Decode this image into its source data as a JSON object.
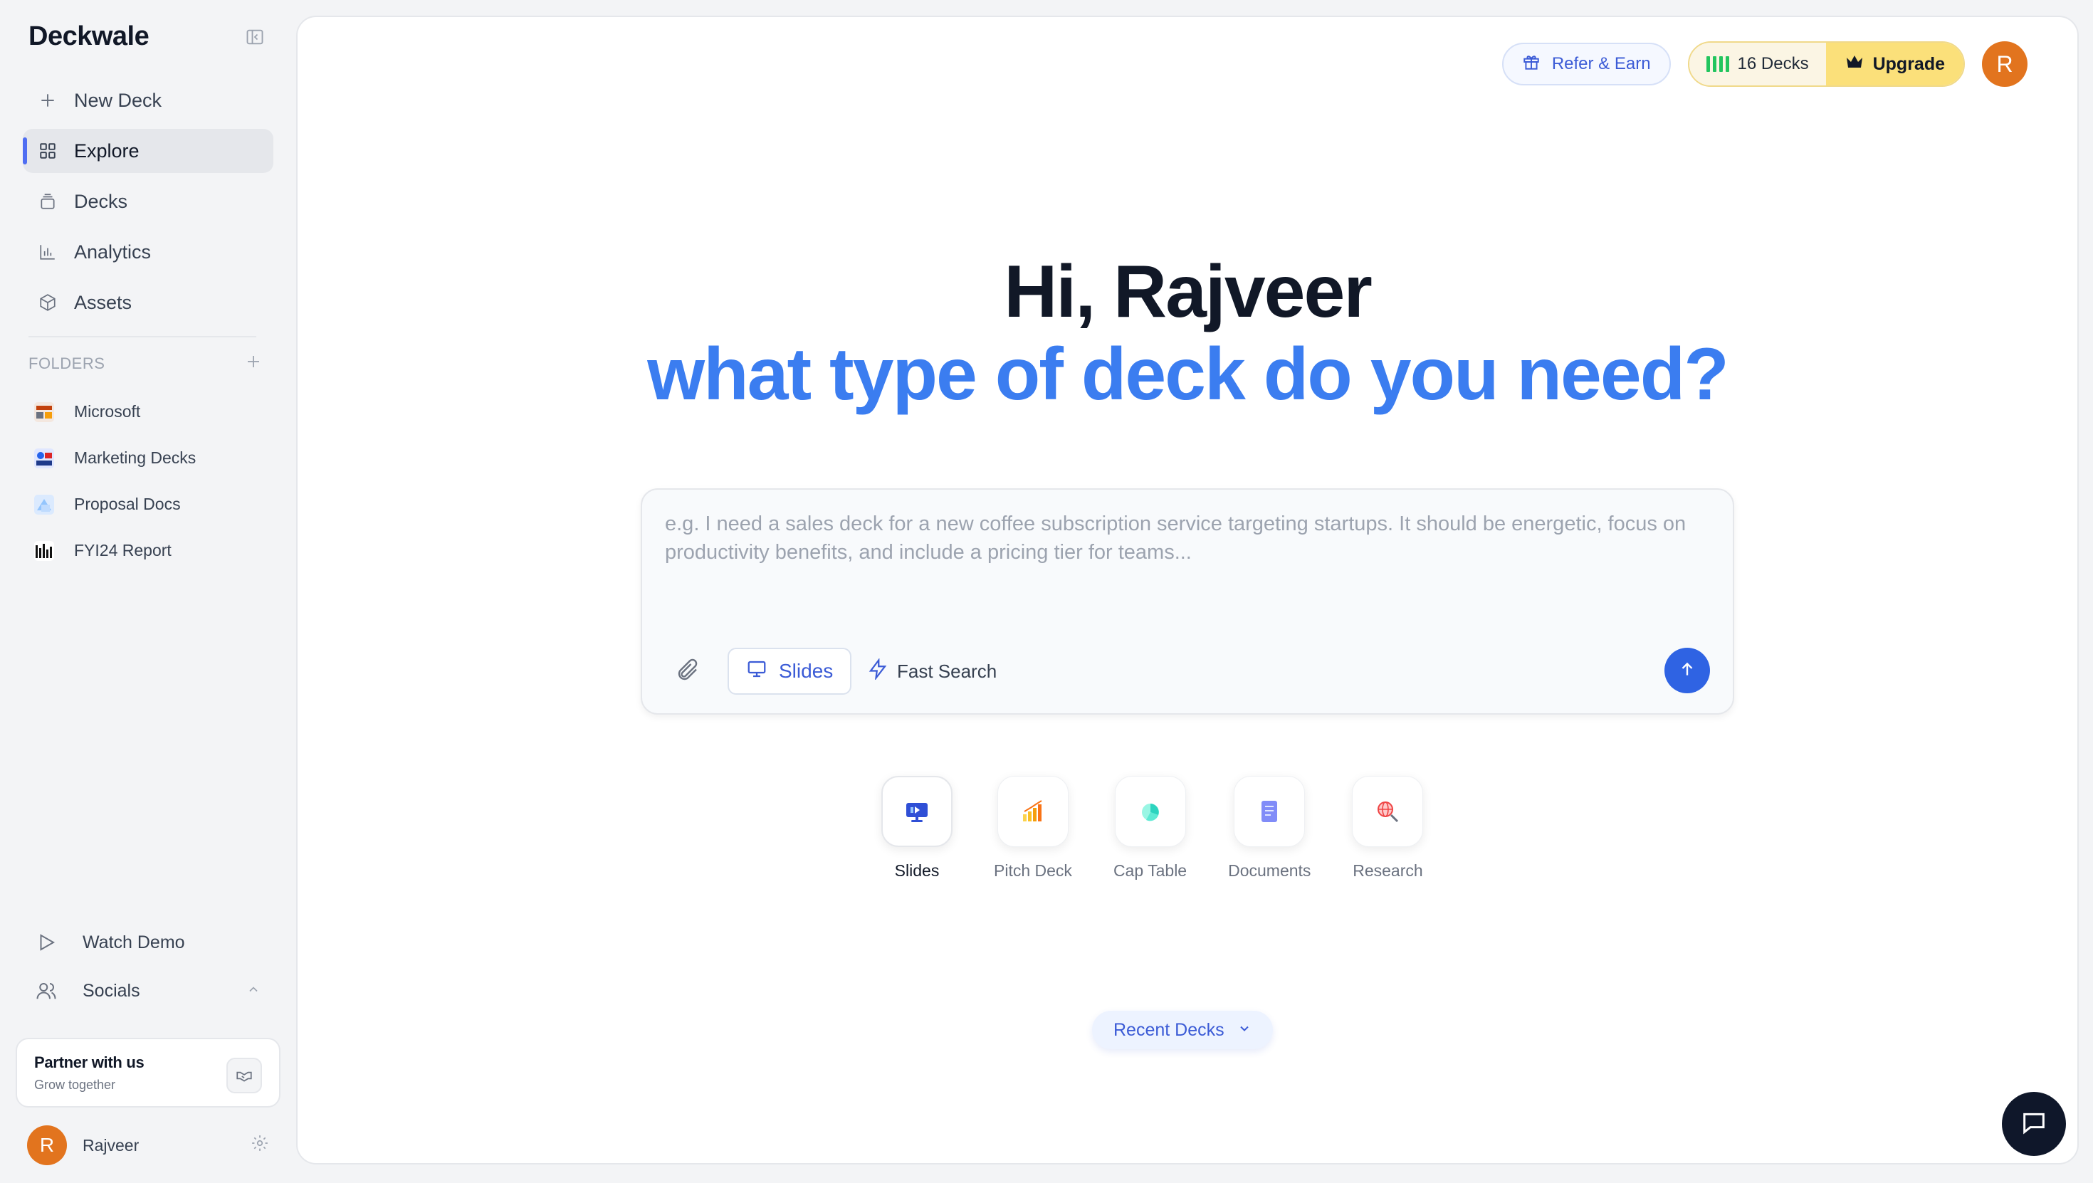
{
  "brand": "Deckwale",
  "nav": [
    {
      "label": "New Deck",
      "icon": "plus-icon"
    },
    {
      "label": "Explore",
      "icon": "grid-icon",
      "active": true
    },
    {
      "label": "Decks",
      "icon": "stack-icon"
    },
    {
      "label": "Analytics",
      "icon": "bar-chart-icon"
    },
    {
      "label": "Assets",
      "icon": "cube-icon"
    }
  ],
  "folders_heading": "FOLDERS",
  "folders": [
    {
      "label": "Microsoft"
    },
    {
      "label": "Marketing Decks"
    },
    {
      "label": "Proposal Docs"
    },
    {
      "label": "FYI24 Report"
    }
  ],
  "bottom_links": {
    "watch_demo": "Watch Demo",
    "socials": "Socials"
  },
  "partner": {
    "title": "Partner with us",
    "subtitle": "Grow together"
  },
  "user": {
    "name": "Rajveer",
    "initial": "R"
  },
  "top_bar": {
    "refer": "Refer & Earn",
    "deck_count": "16 Decks",
    "upgrade": "Upgrade"
  },
  "hero": {
    "greeting": "Hi, Rajveer",
    "question": "what type of deck do you need?"
  },
  "prompt": {
    "placeholder": "e.g. I need a sales deck for a new coffee subscription service targeting startups. It should be energetic, focus on productivity benefits, and include a pricing tier for teams...",
    "mode": "Slides",
    "fast_search": "Fast Search"
  },
  "quick_types": [
    {
      "label": "Slides",
      "icon": "presentation-icon",
      "active": true
    },
    {
      "label": "Pitch Deck",
      "icon": "growth-chart-icon"
    },
    {
      "label": "Cap Table",
      "icon": "pie-chart-icon"
    },
    {
      "label": "Documents",
      "icon": "document-icon"
    },
    {
      "label": "Research",
      "icon": "research-globe-icon"
    }
  ],
  "recent_decks": "Recent Decks",
  "colors": {
    "accent": "#3b7df0",
    "primary_button": "#2f63e3",
    "upgrade": "#fbe07a",
    "avatar": "#e2741e"
  }
}
